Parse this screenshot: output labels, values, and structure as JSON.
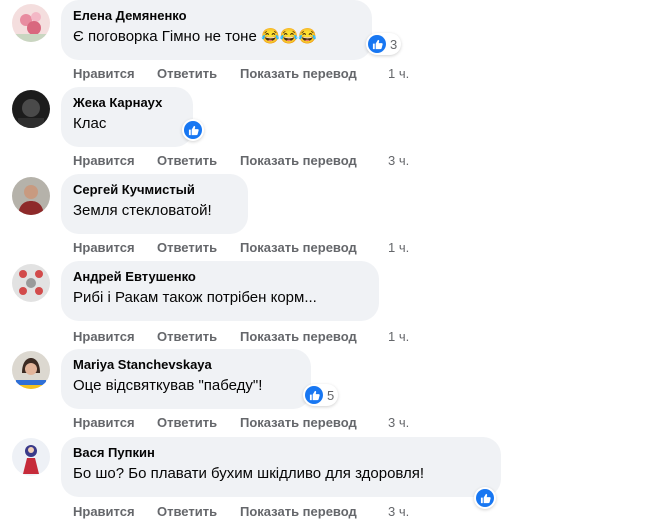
{
  "comments": [
    {
      "author": "Елена Демяненко",
      "text": "Є поговорка Гімно не тоне",
      "emojis": "😂😂😂",
      "reaction_count": "3",
      "like": "Нравится",
      "reply": "Ответить",
      "translate": "Показать перевод",
      "time": "1 ч."
    },
    {
      "author": "Жека Карнаух",
      "text": "Клас",
      "reaction_count": "",
      "like": "Нравится",
      "reply": "Ответить",
      "translate": "Показать перевод",
      "time": "3 ч."
    },
    {
      "author": "Сергей Кучмистый",
      "text": "Земля стекловатой!",
      "like": "Нравится",
      "reply": "Ответить",
      "translate": "Показать перевод",
      "time": "1 ч."
    },
    {
      "author": "Андрей Евтушенко",
      "text": "Рибі і Ракам також потрібен корм...",
      "like": "Нравится",
      "reply": "Ответить",
      "translate": "Показать перевод",
      "time": "1 ч."
    },
    {
      "author": "Mariya Stanchevskaya",
      "text": "Оце відсвяткував \"пабеду\"!",
      "reaction_count": "5",
      "like": "Нравится",
      "reply": "Ответить",
      "translate": "Показать перевод",
      "time": "3 ч."
    },
    {
      "author": "Вася Пупкин",
      "text": "Бо шо? Бо плавати бухим шкідливо для здоровля!",
      "reaction_count": "",
      "like": "Нравится",
      "reply": "Ответить",
      "translate": "Показать перевод",
      "time": "3 ч."
    }
  ],
  "colors": {
    "bubble": "#f0f2f5",
    "like_blue": "#1877f2",
    "meta_text": "#65676b"
  },
  "icons": {
    "reaction": "like-thumb-icon"
  }
}
